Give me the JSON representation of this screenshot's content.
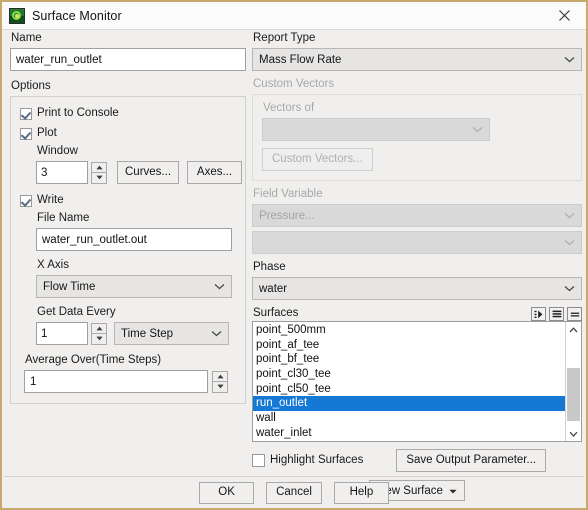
{
  "window": {
    "title": "Surface Monitor",
    "app_icon": "contour-plot-icon",
    "close_icon": "close-icon",
    "border_color": "#c8a96b",
    "titlebar_bg": "#fbfbfb",
    "dialog_bg": "#f0efee",
    "selection_color": "#1578d4"
  },
  "left": {
    "name_label": "Name",
    "name_value": "water_run_outlet",
    "options_label": "Options",
    "print_to_console": {
      "label": "Print to Console",
      "checked": true
    },
    "plot": {
      "label": "Plot",
      "checked": true
    },
    "window_label": "Window",
    "window_value": "3",
    "curves_button": "Curves...",
    "axes_button": "Axes...",
    "write": {
      "label": "Write",
      "checked": true
    },
    "file_name_label": "File Name",
    "file_name_value": "water_run_outlet.out",
    "x_axis_label": "X Axis",
    "x_axis_value": "Flow Time",
    "get_data_every_label": "Get Data Every",
    "get_data_every_value": "1",
    "get_data_every_unit": "Time Step",
    "average_over_label": "Average Over(Time Steps)",
    "average_over_value": "1"
  },
  "right": {
    "report_type_label": "Report Type",
    "report_type_value": "Mass Flow Rate",
    "custom_vectors_label": "Custom Vectors",
    "vectors_of_label": "Vectors of",
    "vectors_of_value": "",
    "custom_vectors_button": "Custom Vectors...",
    "field_variable_label": "Field Variable",
    "field_variable_value": "Pressure...",
    "field_variable_sub_value": "",
    "phase_label": "Phase",
    "phase_value": "water",
    "surfaces_label": "Surfaces",
    "surfaces_tools": [
      {
        "name": "filter-list-icon"
      },
      {
        "name": "select-all-list-icon"
      },
      {
        "name": "deselect-all-list-icon"
      }
    ],
    "surfaces": [
      {
        "label": "point_500mm",
        "selected": false
      },
      {
        "label": "point_af_tee",
        "selected": false
      },
      {
        "label": "point_bf_tee",
        "selected": false
      },
      {
        "label": "point_cl30_tee",
        "selected": false
      },
      {
        "label": "point_cl50_tee",
        "selected": false
      },
      {
        "label": "run_outlet",
        "selected": true
      },
      {
        "label": "wall",
        "selected": false
      },
      {
        "label": "water_inlet",
        "selected": false
      }
    ],
    "highlight_surfaces": {
      "label": "Highlight Surfaces",
      "checked": false
    },
    "save_output_parameter_button": "Save Output Parameter...",
    "new_surface_button": "New Surface"
  },
  "footer": {
    "ok": "OK",
    "cancel": "Cancel",
    "help": "Help"
  }
}
